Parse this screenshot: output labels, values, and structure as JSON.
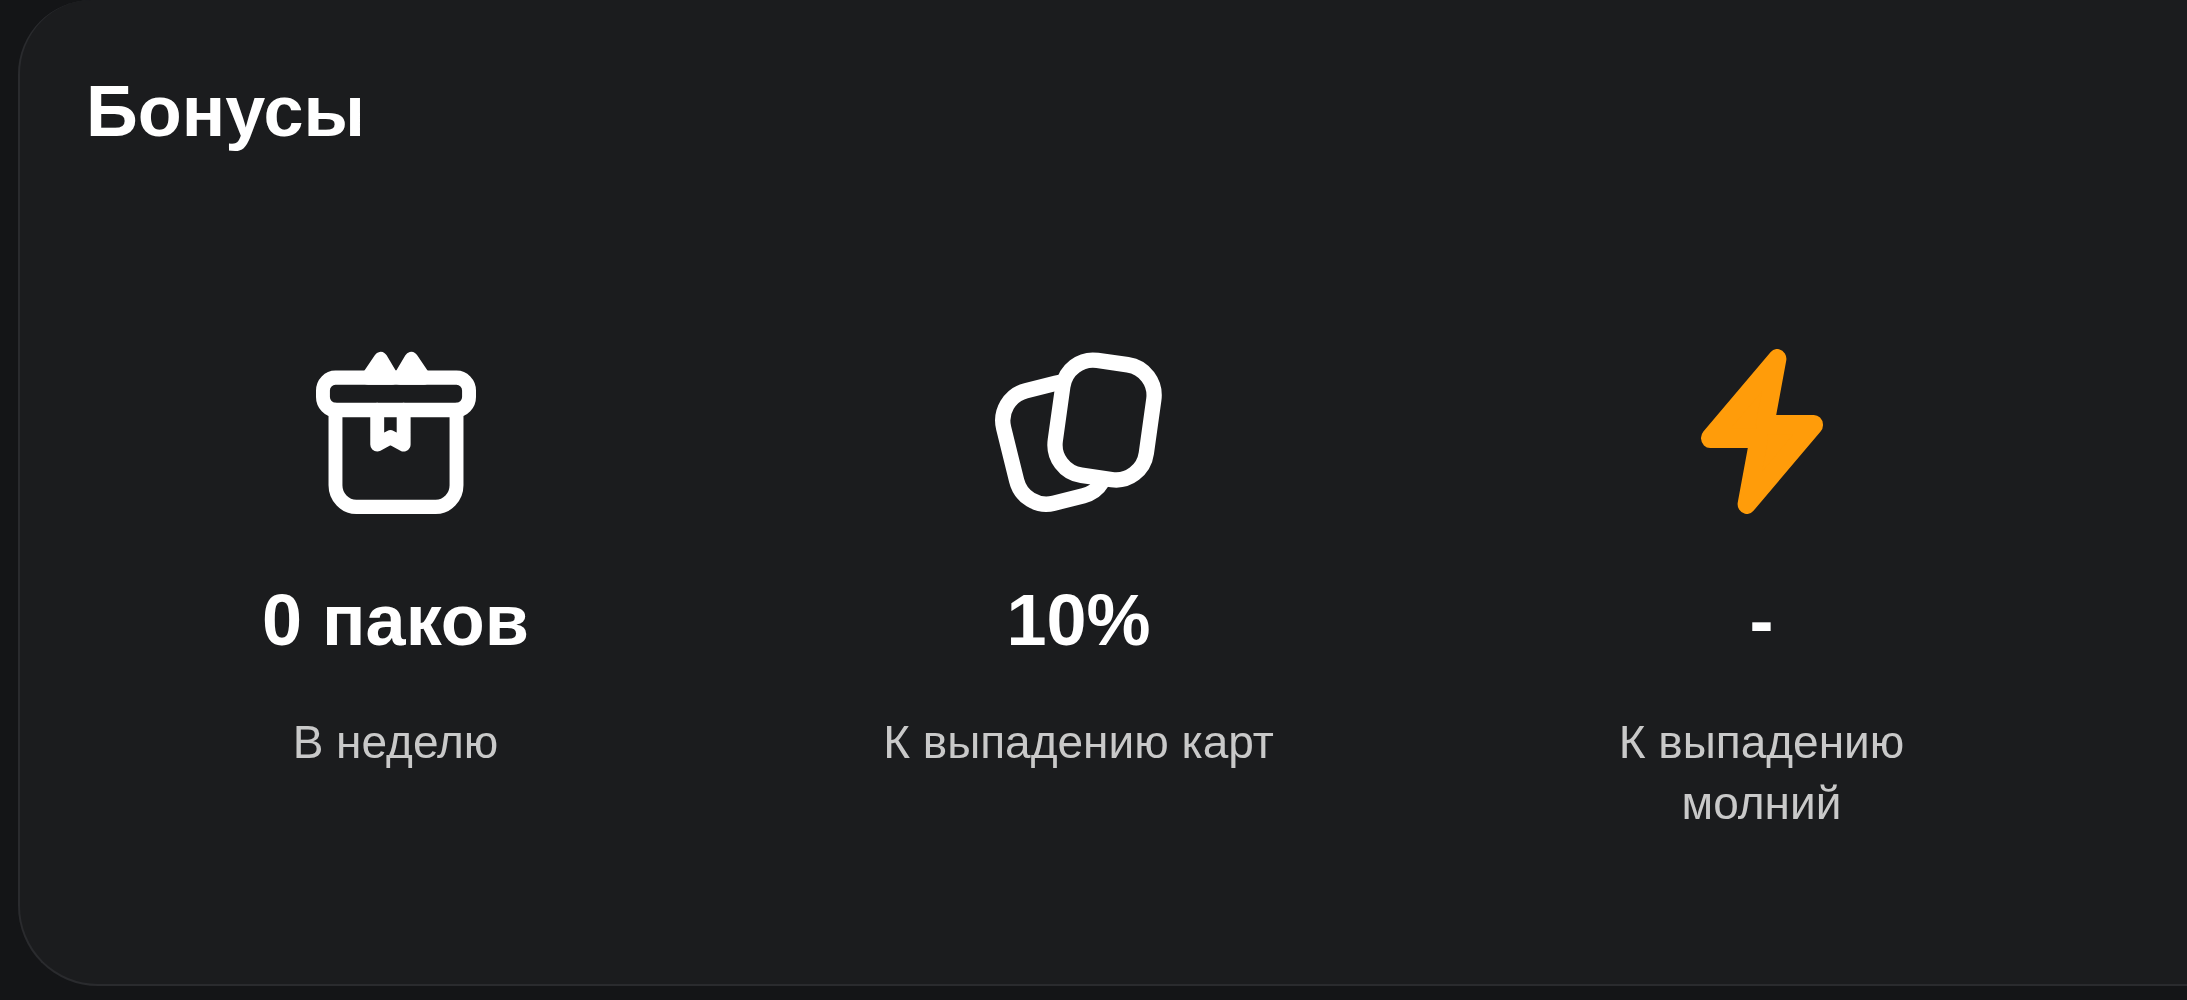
{
  "title": "Бонусы",
  "bonuses": [
    {
      "kind": "gift",
      "value": "0 паков",
      "caption": "В неделю"
    },
    {
      "kind": "cards",
      "value": "10%",
      "caption": "К выпадению карт"
    },
    {
      "kind": "bolt",
      "value": "-",
      "caption": "К выпадению молний"
    }
  ]
}
